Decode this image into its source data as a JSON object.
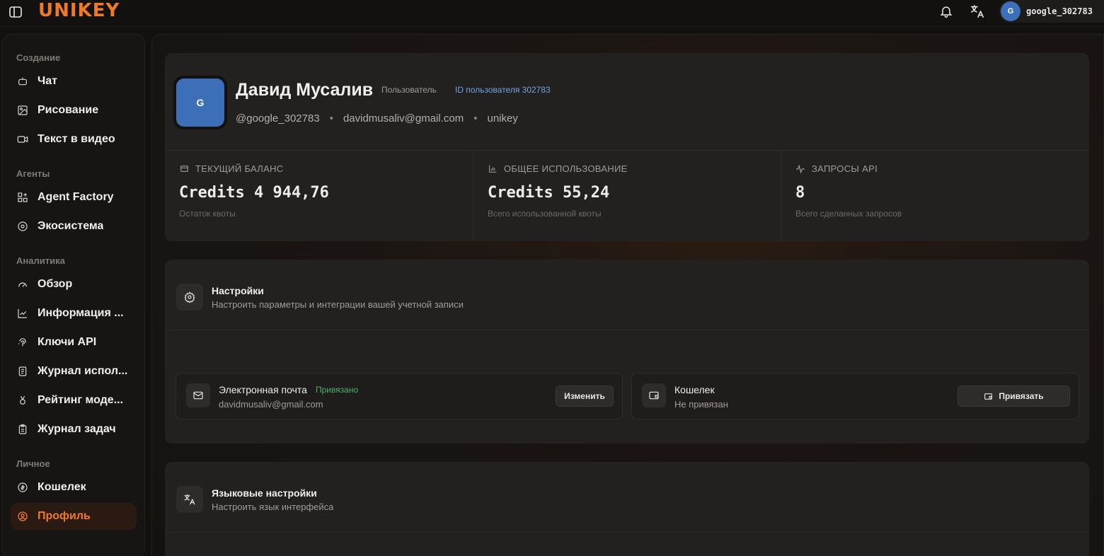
{
  "app": {
    "logo": "UNIKEY"
  },
  "header": {
    "user_initial": "G",
    "username": "google_302783",
    "icons": [
      "panel-toggle-icon",
      "bell-icon",
      "translate-icon"
    ]
  },
  "sidebar": {
    "sections": [
      {
        "title": "Создание",
        "items": [
          {
            "label": "Чат",
            "icon": "chat-bot-icon"
          },
          {
            "label": "Рисование",
            "icon": "image-icon"
          },
          {
            "label": "Текст в видео",
            "icon": "video-icon"
          }
        ]
      },
      {
        "title": "Агенты",
        "items": [
          {
            "label": "Agent Factory",
            "icon": "grid-plus-icon"
          },
          {
            "label": "Экосистема",
            "icon": "ecosystem-icon"
          }
        ]
      },
      {
        "title": "Аналитика",
        "items": [
          {
            "label": "Обзор",
            "icon": "gauge-icon"
          },
          {
            "label": "Информация ...",
            "icon": "chart-line-icon"
          },
          {
            "label": "Ключи API",
            "icon": "fingerprint-icon"
          },
          {
            "label": "Журнал испол...",
            "icon": "log-icon"
          },
          {
            "label": "Рейтинг моде...",
            "icon": "medal-icon"
          },
          {
            "label": "Журнал задач",
            "icon": "clipboard-icon"
          }
        ]
      },
      {
        "title": "Личное",
        "items": [
          {
            "label": "Кошелек",
            "icon": "coin-icon"
          },
          {
            "label": "Профиль",
            "icon": "user-circle-icon",
            "active": true
          }
        ]
      }
    ]
  },
  "profile": {
    "initial": "G",
    "name": "Давид Мусалив",
    "role": "Пользователь",
    "user_id": "ID пользователя 302783",
    "handle": "@google_302783",
    "email": "davidmusaliv@gmail.com",
    "group": "unikey",
    "sep": "•"
  },
  "stats": [
    {
      "label": "ТЕКУЩИЙ БАЛАНС",
      "value": "Credits 4 944,76",
      "sub": "Остаток квоты",
      "icon": "wallet-icon"
    },
    {
      "label": "ОБЩЕЕ ИСПОЛЬЗОВАНИЕ",
      "value": "Credits 55,24",
      "sub": "Всего использованной квоты",
      "icon": "bar-chart-icon"
    },
    {
      "label": "ЗАПРОСЫ API",
      "value": "8",
      "sub": "Всего сделанных запросов",
      "icon": "activity-icon"
    }
  ],
  "settings": {
    "title": "Настройки",
    "subtitle": "Настроить параметры и интеграции вашей учетной записи",
    "email_box": {
      "title": "Электронная почта",
      "status": "Привязано",
      "value": "davidmusaliv@gmail.com",
      "button": "Изменить"
    },
    "wallet_box": {
      "title": "Кошелек",
      "value": "Не привязан",
      "button": "Привязать"
    }
  },
  "language": {
    "title": "Языковые настройки",
    "subtitle": "Настроить язык интерфейса"
  },
  "colors": {
    "accent": "#f07a24",
    "link": "#6fa4de",
    "success": "#4caf6a",
    "avatar": "#3c6fb8"
  }
}
